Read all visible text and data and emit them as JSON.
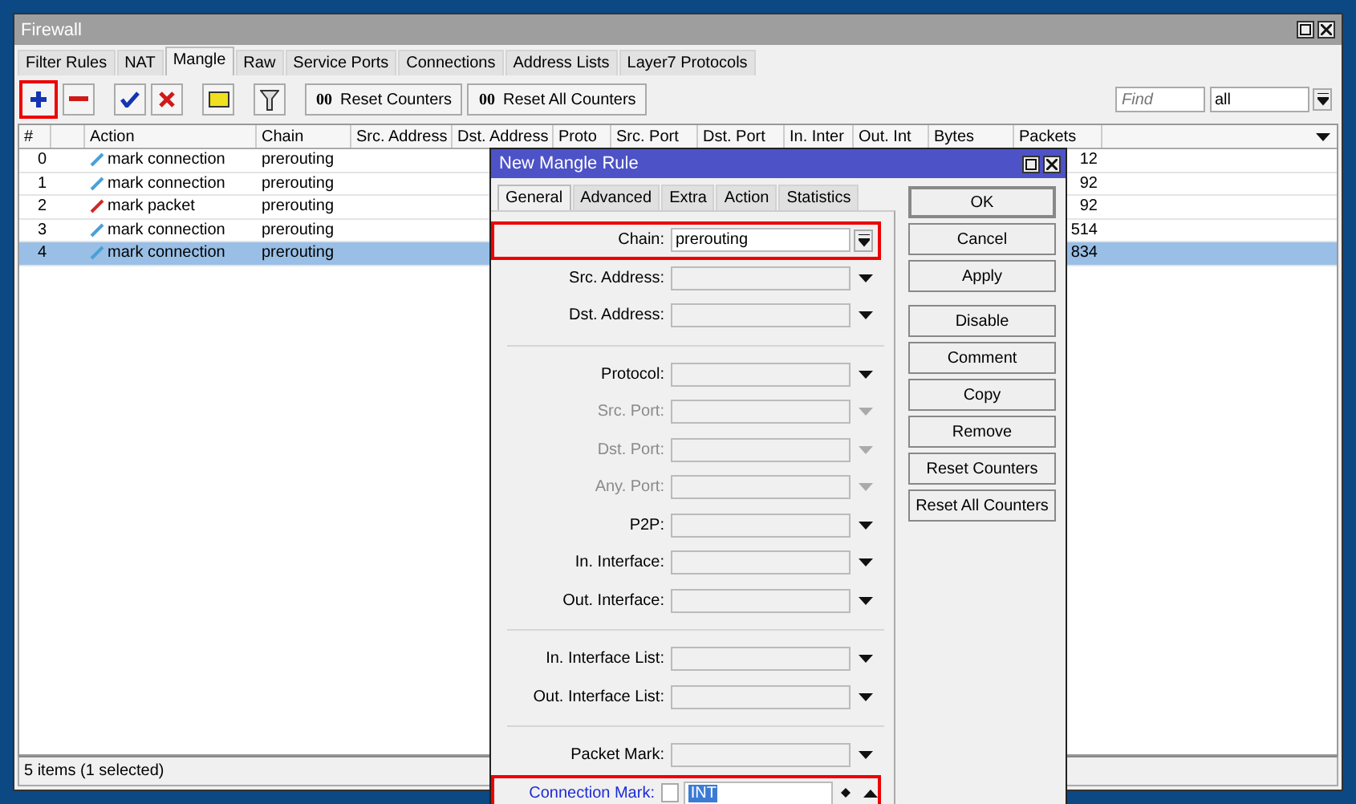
{
  "window": {
    "title": "Firewall"
  },
  "tabs": [
    {
      "label": "Filter Rules",
      "selected": false
    },
    {
      "label": "NAT",
      "selected": false
    },
    {
      "label": "Mangle",
      "selected": true
    },
    {
      "label": "Raw",
      "selected": false
    },
    {
      "label": "Service Ports",
      "selected": false
    },
    {
      "label": "Connections",
      "selected": false
    },
    {
      "label": "Address Lists",
      "selected": false
    },
    {
      "label": "Layer7 Protocols",
      "selected": false
    }
  ],
  "toolbar": {
    "add_highlighted": true,
    "buttons": [
      {
        "kind": "add"
      },
      {
        "kind": "remove"
      },
      {
        "kind": "enable"
      },
      {
        "kind": "disable"
      },
      {
        "kind": "comment"
      },
      {
        "kind": "filter"
      }
    ],
    "counter_buttons": [
      {
        "icon": "00",
        "label": "Reset Counters"
      },
      {
        "icon": "00",
        "label": "Reset All Counters"
      }
    ],
    "find": {
      "placeholder": "Find"
    },
    "filter_value": "all"
  },
  "table": {
    "columns": [
      "#",
      "",
      "Action",
      "Chain",
      "Src. Address",
      "Dst. Address",
      "Proto",
      "Src. Port",
      "Dst. Port",
      "In. Inter",
      "Out. Int",
      "Bytes",
      "Packets"
    ],
    "rows": [
      {
        "num": "0",
        "kind": "connection",
        "action": "mark connection",
        "chain": "prerouting",
        "packets": "12",
        "selected": false
      },
      {
        "num": "1",
        "kind": "connection",
        "action": "mark connection",
        "chain": "prerouting",
        "packets": "92",
        "selected": false
      },
      {
        "num": "2",
        "kind": "packet",
        "action": "mark packet",
        "chain": "prerouting",
        "packets": "92",
        "selected": false
      },
      {
        "num": "3",
        "kind": "connection",
        "action": "mark connection",
        "chain": "prerouting",
        "packets": "514",
        "selected": false
      },
      {
        "num": "4",
        "kind": "connection",
        "action": "mark connection",
        "chain": "prerouting",
        "packets": "834",
        "selected": true
      }
    ]
  },
  "status_bar": "5 items (1 selected)",
  "dialog": {
    "title": "New Mangle Rule",
    "tabs": [
      {
        "label": "General",
        "selected": true
      },
      {
        "label": "Advanced",
        "selected": false
      },
      {
        "label": "Extra",
        "selected": false
      },
      {
        "label": "Action",
        "selected": false
      },
      {
        "label": "Statistics",
        "selected": false
      }
    ],
    "fields": [
      {
        "kind": "combo",
        "label": "Chain:",
        "value": "prerouting",
        "disabled": false,
        "highlighted": true
      },
      {
        "kind": "dropdown",
        "label": "Src. Address:",
        "disabled": false,
        "highlighted": false
      },
      {
        "kind": "dropdown",
        "label": "Dst. Address:",
        "disabled": false,
        "highlighted": false
      },
      {
        "kind": "separator"
      },
      {
        "kind": "dropdown",
        "label": "Protocol:",
        "disabled": false,
        "highlighted": false
      },
      {
        "kind": "dropdown",
        "label": "Src. Port:",
        "disabled": true,
        "highlighted": false
      },
      {
        "kind": "dropdown",
        "label": "Dst. Port:",
        "disabled": true,
        "highlighted": false
      },
      {
        "kind": "dropdown",
        "label": "Any. Port:",
        "disabled": true,
        "highlighted": false
      },
      {
        "kind": "dropdown",
        "label": "P2P:",
        "disabled": false,
        "highlighted": false
      },
      {
        "kind": "dropdown",
        "label": "In. Interface:",
        "disabled": false,
        "highlighted": false
      },
      {
        "kind": "dropdown",
        "label": "Out. Interface:",
        "disabled": false,
        "highlighted": false
      },
      {
        "kind": "separator"
      },
      {
        "kind": "dropdown",
        "label": "In. Interface List:",
        "disabled": false,
        "highlighted": false
      },
      {
        "kind": "dropdown",
        "label": "Out. Interface List:",
        "disabled": false,
        "highlighted": false
      },
      {
        "kind": "separator"
      },
      {
        "kind": "dropdown",
        "label": "Packet Mark:",
        "disabled": false,
        "highlighted": false
      },
      {
        "kind": "mark",
        "label": "Connection Mark:",
        "value": "INT",
        "negated": false,
        "disabled": false,
        "highlighted": true
      }
    ],
    "button_groups": [
      [
        "OK",
        "Cancel",
        "Apply"
      ],
      [
        "Disable",
        "Comment",
        "Copy",
        "Remove",
        "Reset Counters",
        "Reset All Counters"
      ]
    ]
  }
}
